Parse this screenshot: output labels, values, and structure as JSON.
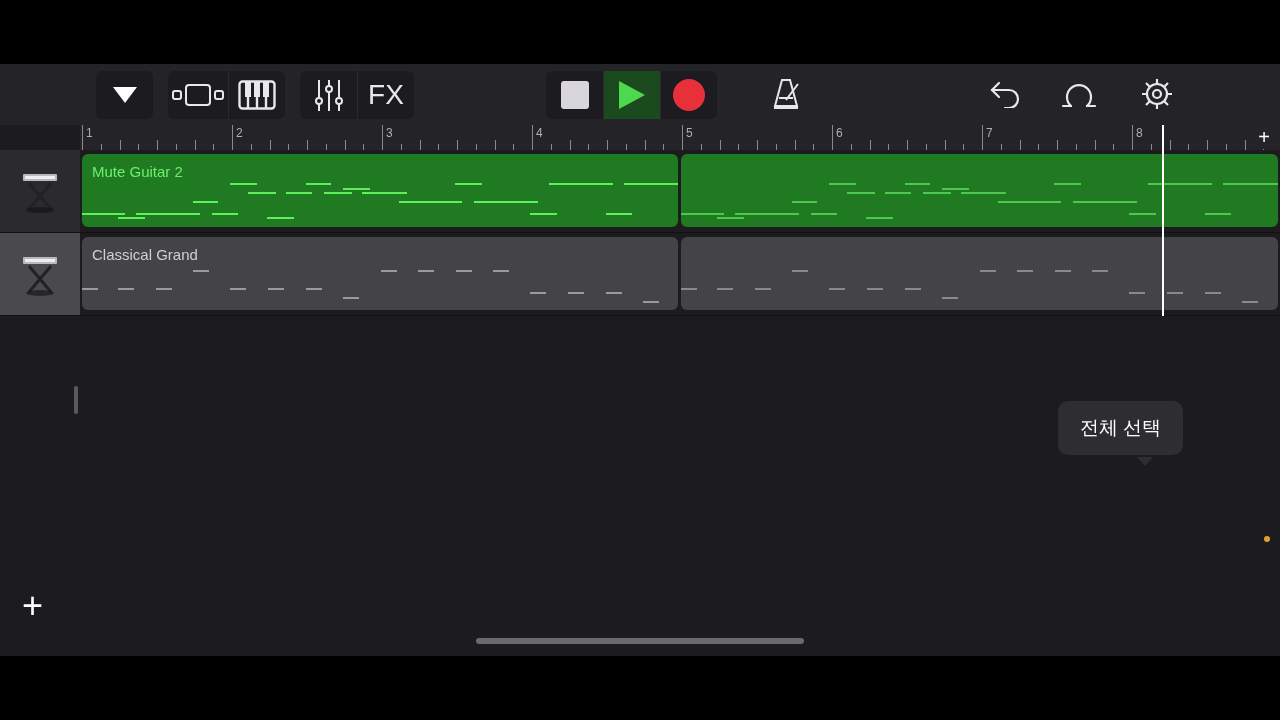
{
  "toolbar": {
    "left": [
      {
        "kind": "dropdown",
        "selected": false
      },
      {
        "kind": "tracks-view",
        "selected": false
      },
      {
        "kind": "keyboard",
        "selected": false
      },
      {
        "kind": "mixer",
        "selected": false
      },
      {
        "kind": "fx",
        "label": "FX",
        "selected": false
      }
    ],
    "transport": [
      {
        "kind": "stop",
        "selected": false
      },
      {
        "kind": "play",
        "selected": true
      },
      {
        "kind": "record",
        "selected": false
      }
    ],
    "right": [
      {
        "kind": "metronome"
      },
      {
        "kind": "undo"
      },
      {
        "kind": "loop"
      },
      {
        "kind": "settings"
      }
    ]
  },
  "ruler": {
    "bars": [
      "1",
      "2",
      "3",
      "4",
      "5",
      "6",
      "7",
      "8"
    ],
    "add_label": "+"
  },
  "add_track": {
    "label": "+"
  },
  "playhead": {
    "level": 0.904
  },
  "tracks": [
    {
      "name": "Mute Guitar 2",
      "selected": false,
      "color": "#1f7a22"
    },
    {
      "name": "Classical Grand",
      "selected": true,
      "color": "#444446"
    }
  ],
  "tooltip": {
    "text": "전체 선택"
  }
}
